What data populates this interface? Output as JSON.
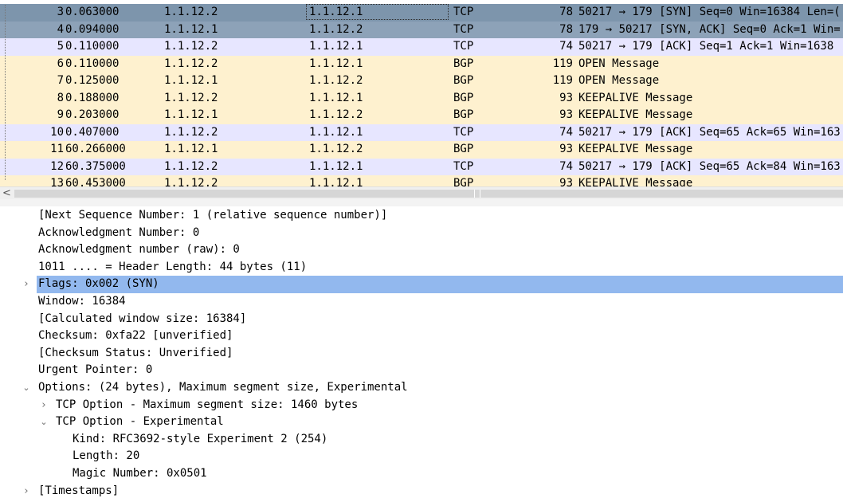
{
  "packet_list": {
    "selected_row": 0,
    "rows": [
      {
        "no": "3",
        "time": "0.063000",
        "src": "1.1.12.2",
        "dst": "1.1.12.1",
        "proto": "TCP",
        "len": "78",
        "info": "50217 → 179 [SYN] Seq=0 Win=16384 Len=(",
        "kind": "tcp",
        "state": "sel first"
      },
      {
        "no": "4",
        "time": "0.094000",
        "src": "1.1.12.1",
        "dst": "1.1.12.2",
        "proto": "TCP",
        "len": "78",
        "info": "179 → 50217 [SYN, ACK] Seq=0 Ack=1 Win=",
        "kind": "tcp",
        "state": "sel"
      },
      {
        "no": "5",
        "time": "0.110000",
        "src": "1.1.12.2",
        "dst": "1.1.12.1",
        "proto": "TCP",
        "len": "74",
        "info": "50217 → 179 [ACK] Seq=1 Ack=1 Win=1638",
        "kind": "tcp",
        "state": ""
      },
      {
        "no": "6",
        "time": "0.110000",
        "src": "1.1.12.2",
        "dst": "1.1.12.1",
        "proto": "BGP",
        "len": "119",
        "info": "OPEN Message",
        "kind": "bgp",
        "state": ""
      },
      {
        "no": "7",
        "time": "0.125000",
        "src": "1.1.12.1",
        "dst": "1.1.12.2",
        "proto": "BGP",
        "len": "119",
        "info": "OPEN Message",
        "kind": "bgp",
        "state": ""
      },
      {
        "no": "8",
        "time": "0.188000",
        "src": "1.1.12.2",
        "dst": "1.1.12.1",
        "proto": "BGP",
        "len": "93",
        "info": "KEEPALIVE Message",
        "kind": "bgp",
        "state": ""
      },
      {
        "no": "9",
        "time": "0.203000",
        "src": "1.1.12.1",
        "dst": "1.1.12.2",
        "proto": "BGP",
        "len": "93",
        "info": "KEEPALIVE Message",
        "kind": "bgp",
        "state": ""
      },
      {
        "no": "10",
        "time": "0.407000",
        "src": "1.1.12.2",
        "dst": "1.1.12.1",
        "proto": "TCP",
        "len": "74",
        "info": "50217 → 179 [ACK] Seq=65 Ack=65 Win=163",
        "kind": "tcp",
        "state": ""
      },
      {
        "no": "11",
        "time": "60.266000",
        "src": "1.1.12.1",
        "dst": "1.1.12.2",
        "proto": "BGP",
        "len": "93",
        "info": "KEEPALIVE Message",
        "kind": "bgp",
        "state": ""
      },
      {
        "no": "12",
        "time": "60.375000",
        "src": "1.1.12.2",
        "dst": "1.1.12.1",
        "proto": "TCP",
        "len": "74",
        "info": "50217 → 179 [ACK] Seq=65 Ack=84 Win=163",
        "kind": "tcp",
        "state": ""
      },
      {
        "no": "13",
        "time": "60.453000",
        "src": "1.1.12.2",
        "dst": "1.1.12.1",
        "proto": "BGP",
        "len": "93",
        "info": "KEEPALIVE Message",
        "kind": "bgp",
        "state": ""
      }
    ]
  },
  "scrollbar": {
    "left_arrow": "<"
  },
  "detail_tree": {
    "rows": [
      {
        "text": "[Next Sequence Number: 1    (relative sequence number)]",
        "level": 0,
        "toggle": "none",
        "selected": false,
        "name": "next-seq-field"
      },
      {
        "text": "Acknowledgment Number: 0",
        "level": 0,
        "toggle": "none",
        "selected": false,
        "name": "ack-number-field"
      },
      {
        "text": "Acknowledgment number (raw): 0",
        "level": 0,
        "toggle": "none",
        "selected": false,
        "name": "ack-raw-field"
      },
      {
        "text": "1011 .... = Header Length: 44 bytes (11)",
        "level": 0,
        "toggle": "none",
        "selected": false,
        "name": "header-length-field"
      },
      {
        "text": "Flags: 0x002 (SYN)",
        "level": 0,
        "toggle": "collapsed",
        "selected": true,
        "name": "flags-field"
      },
      {
        "text": "Window: 16384",
        "level": 0,
        "toggle": "none",
        "selected": false,
        "name": "window-field"
      },
      {
        "text": "[Calculated window size: 16384]",
        "level": 0,
        "toggle": "none",
        "selected": false,
        "name": "calc-window-field"
      },
      {
        "text": "Checksum: 0xfa22 [unverified]",
        "level": 0,
        "toggle": "none",
        "selected": false,
        "name": "checksum-field"
      },
      {
        "text": "[Checksum Status: Unverified]",
        "level": 0,
        "toggle": "none",
        "selected": false,
        "name": "checksum-status-field"
      },
      {
        "text": "Urgent Pointer: 0",
        "level": 0,
        "toggle": "none",
        "selected": false,
        "name": "urgent-pointer-field"
      },
      {
        "text": "Options: (24 bytes), Maximum segment size, Experimental",
        "level": 0,
        "toggle": "expanded",
        "selected": false,
        "name": "options-field"
      },
      {
        "text": "TCP Option - Maximum segment size: 1460 bytes",
        "level": 1,
        "toggle": "collapsed",
        "selected": false,
        "name": "option-mss-field"
      },
      {
        "text": "TCP Option - Experimental",
        "level": 1,
        "toggle": "expanded",
        "selected": false,
        "name": "option-experimental-field"
      },
      {
        "text": "Kind: RFC3692-style Experiment 2 (254)",
        "level": 2,
        "toggle": "none",
        "selected": false,
        "name": "kind-field"
      },
      {
        "text": "Length: 20",
        "level": 2,
        "toggle": "none",
        "selected": false,
        "name": "length-field"
      },
      {
        "text": "Magic Number: 0x0501",
        "level": 2,
        "toggle": "none",
        "selected": false,
        "name": "magic-number-field"
      },
      {
        "text": "[Timestamps]",
        "level": 0,
        "toggle": "collapsed",
        "selected": false,
        "name": "timestamps-field"
      }
    ]
  },
  "icons": {
    "collapsed": "chevron-right-icon",
    "expanded": "chevron-down-icon",
    "collapsed_glyph": "›",
    "expanded_glyph": "⌄"
  },
  "colors": {
    "tcp_row": "#e7e6ff",
    "bgp_row": "#fef1cf",
    "selected_row": "#8da2b8",
    "selected_tree_item": "#92b8ee"
  }
}
